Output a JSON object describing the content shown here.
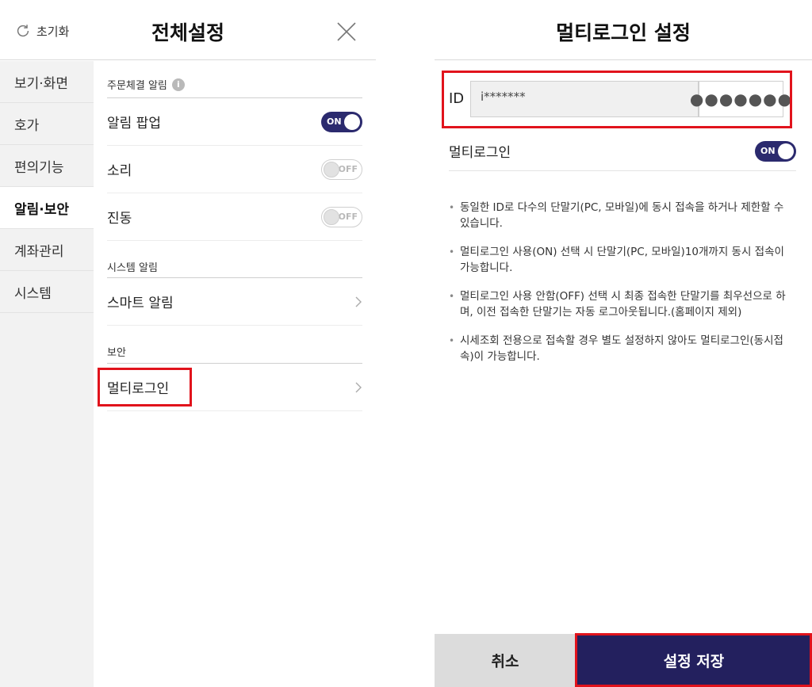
{
  "left": {
    "reset_label": "초기화",
    "title": "전체설정",
    "sidebar": {
      "items": [
        {
          "label": "보기·화면"
        },
        {
          "label": "호가"
        },
        {
          "label": "편의기능"
        },
        {
          "label": "알림·보안",
          "active": true
        },
        {
          "label": "계좌관리"
        },
        {
          "label": "시스템"
        }
      ]
    },
    "sections": {
      "order_alert": {
        "header": "주문체결 알림",
        "info_icon": "i",
        "rows": [
          {
            "label": "알림 팝업",
            "state": "ON"
          },
          {
            "label": "소리",
            "state": "OFF"
          },
          {
            "label": "진동",
            "state": "OFF"
          }
        ]
      },
      "system_alert": {
        "header": "시스템 알림",
        "rows": [
          {
            "label": "스마트 알림"
          }
        ]
      },
      "security": {
        "header": "보안",
        "rows": [
          {
            "label": "멀티로그인"
          }
        ]
      }
    }
  },
  "right": {
    "title": "멀티로그인 설정",
    "id_label": "ID",
    "id_value": "i*******",
    "password_value": "●●●●●●●",
    "multi_login_label": "멀티로그인",
    "multi_login_state": "ON",
    "notes": [
      "동일한 ID로 다수의 단말기(PC, 모바일)에 동시 접속을 하거나 제한할 수 있습니다.",
      "멀티로그인 사용(ON) 선택 시 단말기(PC, 모바일)10개까지 동시 접속이 가능합니다.",
      "멀티로그인 사용 안함(OFF) 선택 시 최종 접속한 단말기를 최우선으로 하며, 이전 접속한 단말기는 자동 로그아웃됩니다.(홈페이지 제외)",
      "시세조회 전용으로 접속할 경우 별도 설정하지 않아도 멀티로그인(동시접속)이 가능합니다."
    ],
    "cancel_label": "취소",
    "save_label": "설정 저장"
  },
  "colors": {
    "accent": "#23205e",
    "toggle_on": "#2b2a6e",
    "highlight": "#e1131c"
  },
  "icons": [
    "refresh-icon",
    "close-icon",
    "info-icon",
    "chevron-right-icon"
  ]
}
